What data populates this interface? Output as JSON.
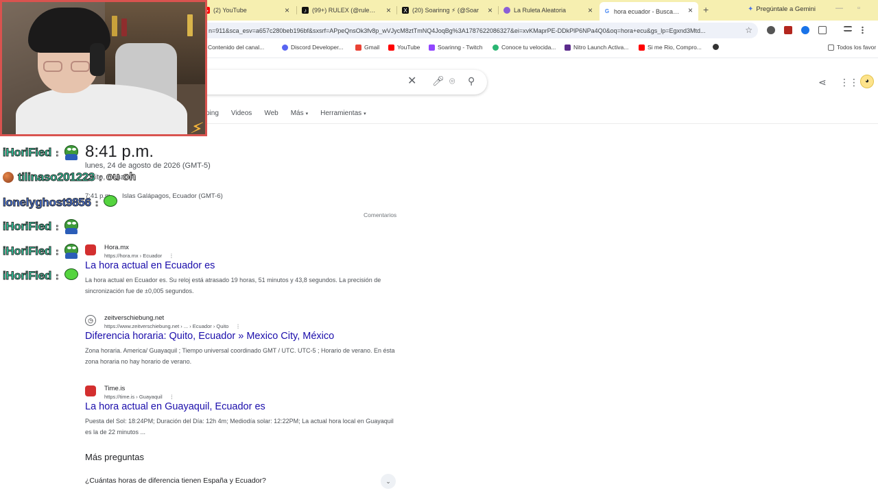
{
  "browser": {
    "tabs": [
      {
        "label": "(2) YouTube",
        "icon": "youtube-icon"
      },
      {
        "label": "(99+) RULEX (@rulexvr) | Ti",
        "icon": "tiktok-icon"
      },
      {
        "label": "(20) Soarinng ⚡ (@Soar",
        "icon": "x-icon"
      },
      {
        "label": "La Ruleta Aleatoria",
        "icon": "roulette-icon"
      },
      {
        "label": "hora ecuador - Buscar con",
        "icon": "google-icon"
      }
    ],
    "new_tab": "+",
    "gemini": "Pregúntale a Gemini",
    "url": "n=911&sca_esv=a657c280beb196bf&sxsrf=APpeQnsOk3fv8p_wVJycM8ztTmNQ4JoqBg%3A1787622086327&ei=xvKMaprPE-DDkPlP6NPa4Q0&oq=hora+ecu&gs_lp=Egxnd3Mtd...",
    "bookmarks": [
      {
        "label": "Contenido del canal...",
        "color": "#e53935"
      },
      {
        "label": "Discord Developer...",
        "color": "#5865f2"
      },
      {
        "label": "Gmail",
        "color": "#ea4335"
      },
      {
        "label": "YouTube",
        "color": "#ff0000"
      },
      {
        "label": "Soarinng - Twitch",
        "color": "#9146ff"
      },
      {
        "label": "Conoce tu velocida...",
        "color": "#2bb673"
      },
      {
        "label": "Nitro Launch Activa...",
        "color": "#5b2b8c"
      },
      {
        "label": "Si me Rio, Compro...",
        "color": "#ff0000"
      },
      {
        "label": "",
        "color": "#333"
      },
      {
        "label": "Todos los favor",
        "color": "#777"
      }
    ]
  },
  "search": {
    "nav": [
      "ping",
      "Videos",
      "Web",
      "Más",
      "Herramientas"
    ]
  },
  "clock": {
    "time": "8:41 p.m.",
    "date": "lunes, 24 de agosto de 2026 (GMT-5)",
    "location": "Quito, Ecuador",
    "other_time": "7:41 p.m.",
    "other_location": "Islas Galápagos, Ecuador (GMT-6)",
    "comments": "Comentarios"
  },
  "results": [
    {
      "site": "Hora.mx",
      "url": "https://hora.mx › Ecuador",
      "title": "La hora actual en Ecuador es",
      "snippet": "La hora actual en Ecuador es. Su reloj está atrasado 19 horas, 51 minutos y 43,8 segundos. La precisión de sincronización fue de ±0,005 segundos.",
      "fav_color": "#d32f2f"
    },
    {
      "site": "zeitverschiebung.net",
      "url": "https://www.zeitverschiebung.net › ... › Ecuador › Quito",
      "title": "Diferencia horaria: Quito, Ecuador » Mexico City, México",
      "snippet": "Zona horaria. America/ Guayaquil ; Tiempo universal coordinado GMT / UTC. UTC-5 ; Horario de verano. En ésta zona horaria no hay horario de verano.",
      "fav_color": "#ffffff"
    },
    {
      "site": "Time.is",
      "url": "https://time.is › Guayaquil",
      "title": "La hora actual en Guayaquil, Ecuador es",
      "snippet": "Puesta del Sol: 18:24PM; Duración del Día: 12h 4m; Mediodía solar: 12:22PM; La actual hora local en Guayaquil es la de 22 minutos ...",
      "fav_color": "#d32f2f"
    }
  ],
  "paa": {
    "title": "Más preguntas",
    "question": "¿Cuántas horas de diferencia tienen España y Ecuador?"
  },
  "chat": [
    {
      "user": "iHoriFied",
      "color": "#2fd6a6",
      "msg": ""
    },
    {
      "user": "tilinaso201223",
      "color": "#2fd6a6",
      "msg": "ou oh"
    },
    {
      "user": "lonelyghost9856",
      "color": "#4a7bf0",
      "msg": ""
    },
    {
      "user": "iHoriFied",
      "color": "#2fd6a6",
      "msg": ""
    },
    {
      "user": "iHoriFied",
      "color": "#2fd6a6",
      "msg": ""
    },
    {
      "user": "iHoriFied",
      "color": "#2fd6a6",
      "msg": ""
    }
  ]
}
